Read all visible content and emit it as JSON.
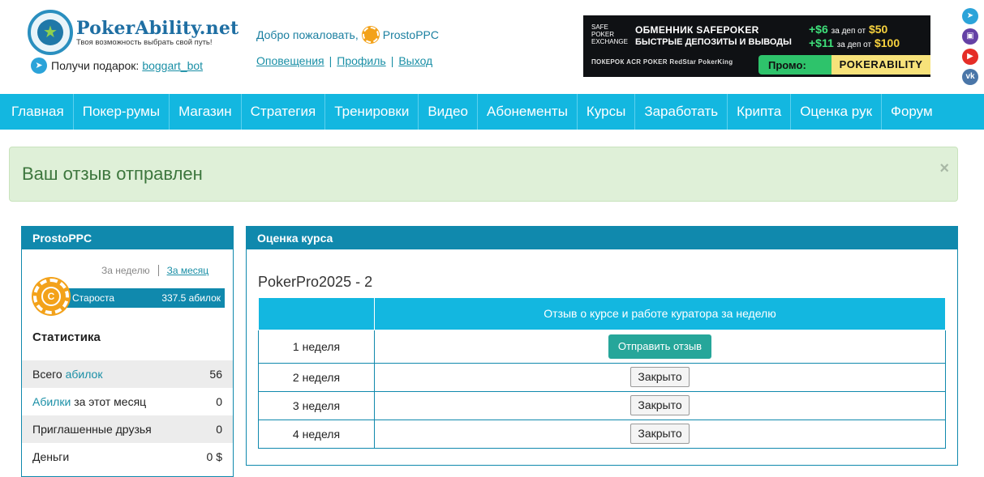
{
  "header": {
    "logo_title": "PokerAbility.net",
    "logo_subtitle": "Твоя возможность выбрать свой путь!",
    "gift_label": "Получи подарок:",
    "gift_link": "boggart_bot",
    "welcome_label": "Добро пожаловать,",
    "username": "ProstoPPC",
    "links": [
      "Оповещения",
      "Профиль",
      "Выход"
    ]
  },
  "banner": {
    "logo": "SAFE POKER EXCHANGE",
    "headline": "ОБМЕННИК SAFEPOKER",
    "subline": "БЫСТРЫЕ ДЕПОЗИТЫ И ВЫВОДЫ",
    "bonus1_amount": "+$6",
    "bonus1_text": "за деп от",
    "bonus1_min": "$50",
    "bonus2_amount": "+$11",
    "bonus2_text": "за деп от",
    "bonus2_min": "$100",
    "rooms": "ПОКЕРОК   ACR POKER   RedStar   PokerKing",
    "promo_label": "Промо:",
    "promo_code": "POKERABILITY"
  },
  "socials": [
    {
      "icon": "telegram-icon",
      "glyph": "➤",
      "color": "#2ba3d9"
    },
    {
      "icon": "twitch-icon",
      "glyph": "▣",
      "color": "#6441a5"
    },
    {
      "icon": "youtube-icon",
      "glyph": "▶",
      "color": "#e52d27"
    },
    {
      "icon": "vk-icon",
      "glyph": "vk",
      "color": "#4a76a8"
    }
  ],
  "nav": [
    "Главная",
    "Покер-румы",
    "Магазин",
    "Стратегия",
    "Тренировки",
    "Видео",
    "Абонементы",
    "Курсы",
    "Заработать",
    "Крипта",
    "Оценка рук",
    "Форум"
  ],
  "alert": {
    "message": "Ваш отзыв отправлен",
    "close": "×"
  },
  "profile": {
    "title": "ProstoPPC",
    "period_week": "За неделю",
    "period_month": "За месяц",
    "chip_letter": "С",
    "rank_name": "Староста",
    "rank_value": "337.5 абилок",
    "stats_title": "Статистика",
    "stats": {
      "total_prefix": "Всего",
      "total_link": "абилок",
      "total_value": "56",
      "month_link": "Абилки",
      "month_suffix": "за этот месяц",
      "month_value": "0",
      "friends_label": "Приглашенные друзья",
      "friends_value": "0",
      "money_label": "Деньги",
      "money_value": "0 $"
    }
  },
  "course": {
    "panel_title": "Оценка курса",
    "course_name": "PokerPro2025 - 2",
    "column_header": "Отзыв о курсе и работе куратора за неделю",
    "rows": [
      {
        "week": "1 неделя",
        "action": "Отправить отзыв"
      },
      {
        "week": "2 неделя",
        "action": "Закрыто"
      },
      {
        "week": "3 неделя",
        "action": "Закрыто"
      },
      {
        "week": "4 неделя",
        "action": "Закрыто"
      }
    ]
  }
}
